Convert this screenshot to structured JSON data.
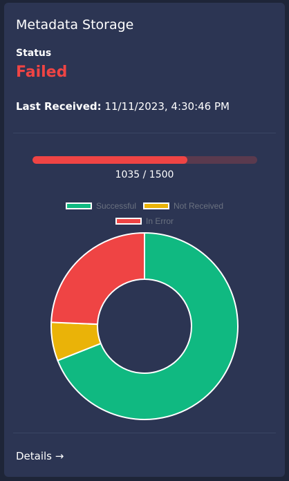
{
  "card": {
    "title": "Metadata Storage",
    "status_label": "Status",
    "status_value": "Failed",
    "status_color": "#ef4444",
    "last_received_label": "Last Received:",
    "last_received_value": "11/11/2023, 4:30:46 PM",
    "details_label": "Details →"
  },
  "progress": {
    "current": 1035,
    "total": 1500,
    "text": "1035 / 1500",
    "fill_color": "#ef4444",
    "track_color": "#5a3a4e"
  },
  "chart_data": {
    "type": "pie",
    "categories": [
      "Successful",
      "Not Received",
      "In Error"
    ],
    "values": [
      1035,
      100,
      365
    ],
    "colors": [
      "#10b981",
      "#eab308",
      "#ef4444"
    ],
    "legend_position": "top"
  }
}
